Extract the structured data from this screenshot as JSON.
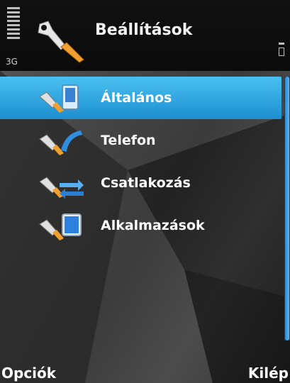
{
  "header": {
    "title": "Beállítások",
    "network": "3G",
    "app_icon": "settings-wrench-icon"
  },
  "menu": {
    "items": [
      {
        "label": "Általános",
        "icon": "general-settings-icon",
        "selected": true
      },
      {
        "label": "Telefon",
        "icon": "phone-settings-icon",
        "selected": false
      },
      {
        "label": "Csatlakozás",
        "icon": "connection-settings-icon",
        "selected": false
      },
      {
        "label": "Alkalmazások",
        "icon": "applications-settings-icon",
        "selected": false
      }
    ]
  },
  "softkeys": {
    "left": "Opciók",
    "right": "Kilép"
  },
  "colors": {
    "highlight": "#2aa6e6",
    "scrollbar": "#3a9be0"
  }
}
